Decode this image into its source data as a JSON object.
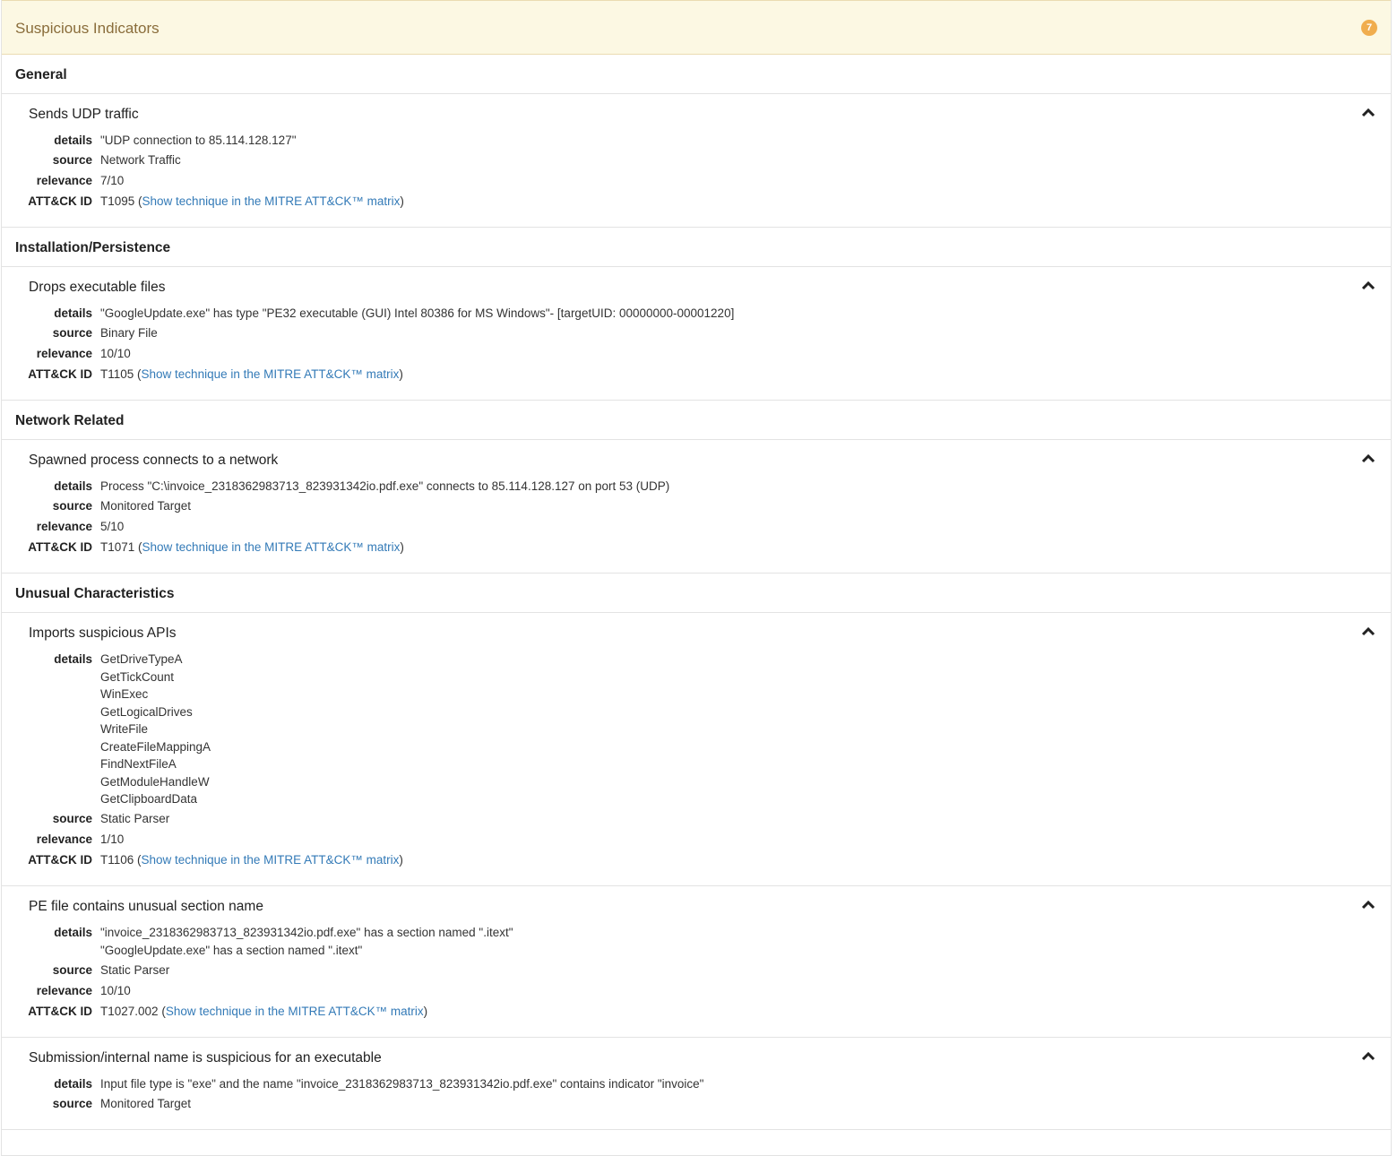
{
  "panel": {
    "title": "Suspicious Indicators",
    "badge": "7"
  },
  "labels": {
    "details": "details",
    "source": "source",
    "relevance": "relevance",
    "attack_id": "ATT&CK ID",
    "link": "Show technique in the MITRE ATT&CK™ matrix"
  },
  "categories": [
    {
      "title": "General",
      "signatures": [
        {
          "title": "Sends UDP traffic",
          "details": [
            "\"UDP connection to 85.114.128.127\""
          ],
          "source": "Network Traffic",
          "relevance": "7/10",
          "attack_id": "T1095"
        }
      ]
    },
    {
      "title": "Installation/Persistence",
      "signatures": [
        {
          "title": "Drops executable files",
          "details": [
            "\"GoogleUpdate.exe\" has type \"PE32 executable (GUI) Intel 80386 for MS Windows\"- [targetUID: 00000000-00001220]"
          ],
          "source": "Binary File",
          "relevance": "10/10",
          "attack_id": "T1105"
        }
      ]
    },
    {
      "title": "Network Related",
      "signatures": [
        {
          "title": "Spawned process connects to a network",
          "details": [
            "Process \"C:\\invoice_2318362983713_823931342io.pdf.exe\" connects to 85.114.128.127 on port 53 (UDP)"
          ],
          "source": "Monitored Target",
          "relevance": "5/10",
          "attack_id": "T1071"
        }
      ]
    },
    {
      "title": "Unusual Characteristics",
      "signatures": [
        {
          "title": "Imports suspicious APIs",
          "details": [
            "GetDriveTypeA",
            "GetTickCount",
            "WinExec",
            "GetLogicalDrives",
            "WriteFile",
            "CreateFileMappingA",
            "FindNextFileA",
            "GetModuleHandleW",
            "GetClipboardData"
          ],
          "source": "Static Parser",
          "relevance": "1/10",
          "attack_id": "T1106"
        },
        {
          "title": "PE file contains unusual section name",
          "details": [
            "\"invoice_2318362983713_823931342io.pdf.exe\" has a section named \".itext\"",
            "\"GoogleUpdate.exe\" has a section named \".itext\""
          ],
          "source": "Static Parser",
          "relevance": "10/10",
          "attack_id": "T1027.002"
        },
        {
          "title": "Submission/internal name is suspicious for an executable",
          "details": [
            "Input file type is \"exe\" and the name \"invoice_2318362983713_823931342io.pdf.exe\" contains indicator \"invoice\""
          ],
          "source": "Monitored Target"
        }
      ]
    }
  ]
}
